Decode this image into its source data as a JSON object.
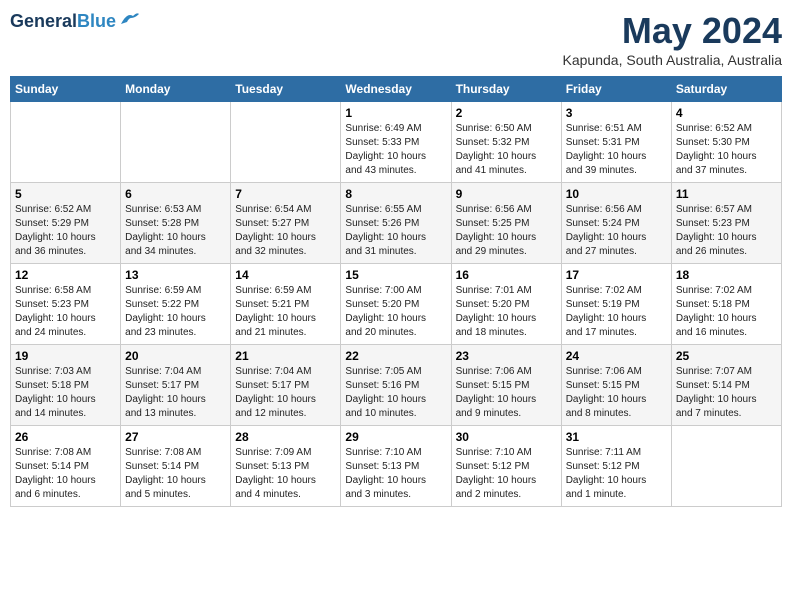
{
  "header": {
    "logo_line1": "General",
    "logo_line2": "Blue",
    "month_year": "May 2024",
    "location": "Kapunda, South Australia, Australia"
  },
  "weekdays": [
    "Sunday",
    "Monday",
    "Tuesday",
    "Wednesday",
    "Thursday",
    "Friday",
    "Saturday"
  ],
  "weeks": [
    [
      {
        "day": "",
        "info": ""
      },
      {
        "day": "",
        "info": ""
      },
      {
        "day": "",
        "info": ""
      },
      {
        "day": "1",
        "info": "Sunrise: 6:49 AM\nSunset: 5:33 PM\nDaylight: 10 hours\nand 43 minutes."
      },
      {
        "day": "2",
        "info": "Sunrise: 6:50 AM\nSunset: 5:32 PM\nDaylight: 10 hours\nand 41 minutes."
      },
      {
        "day": "3",
        "info": "Sunrise: 6:51 AM\nSunset: 5:31 PM\nDaylight: 10 hours\nand 39 minutes."
      },
      {
        "day": "4",
        "info": "Sunrise: 6:52 AM\nSunset: 5:30 PM\nDaylight: 10 hours\nand 37 minutes."
      }
    ],
    [
      {
        "day": "5",
        "info": "Sunrise: 6:52 AM\nSunset: 5:29 PM\nDaylight: 10 hours\nand 36 minutes."
      },
      {
        "day": "6",
        "info": "Sunrise: 6:53 AM\nSunset: 5:28 PM\nDaylight: 10 hours\nand 34 minutes."
      },
      {
        "day": "7",
        "info": "Sunrise: 6:54 AM\nSunset: 5:27 PM\nDaylight: 10 hours\nand 32 minutes."
      },
      {
        "day": "8",
        "info": "Sunrise: 6:55 AM\nSunset: 5:26 PM\nDaylight: 10 hours\nand 31 minutes."
      },
      {
        "day": "9",
        "info": "Sunrise: 6:56 AM\nSunset: 5:25 PM\nDaylight: 10 hours\nand 29 minutes."
      },
      {
        "day": "10",
        "info": "Sunrise: 6:56 AM\nSunset: 5:24 PM\nDaylight: 10 hours\nand 27 minutes."
      },
      {
        "day": "11",
        "info": "Sunrise: 6:57 AM\nSunset: 5:23 PM\nDaylight: 10 hours\nand 26 minutes."
      }
    ],
    [
      {
        "day": "12",
        "info": "Sunrise: 6:58 AM\nSunset: 5:23 PM\nDaylight: 10 hours\nand 24 minutes."
      },
      {
        "day": "13",
        "info": "Sunrise: 6:59 AM\nSunset: 5:22 PM\nDaylight: 10 hours\nand 23 minutes."
      },
      {
        "day": "14",
        "info": "Sunrise: 6:59 AM\nSunset: 5:21 PM\nDaylight: 10 hours\nand 21 minutes."
      },
      {
        "day": "15",
        "info": "Sunrise: 7:00 AM\nSunset: 5:20 PM\nDaylight: 10 hours\nand 20 minutes."
      },
      {
        "day": "16",
        "info": "Sunrise: 7:01 AM\nSunset: 5:20 PM\nDaylight: 10 hours\nand 18 minutes."
      },
      {
        "day": "17",
        "info": "Sunrise: 7:02 AM\nSunset: 5:19 PM\nDaylight: 10 hours\nand 17 minutes."
      },
      {
        "day": "18",
        "info": "Sunrise: 7:02 AM\nSunset: 5:18 PM\nDaylight: 10 hours\nand 16 minutes."
      }
    ],
    [
      {
        "day": "19",
        "info": "Sunrise: 7:03 AM\nSunset: 5:18 PM\nDaylight: 10 hours\nand 14 minutes."
      },
      {
        "day": "20",
        "info": "Sunrise: 7:04 AM\nSunset: 5:17 PM\nDaylight: 10 hours\nand 13 minutes."
      },
      {
        "day": "21",
        "info": "Sunrise: 7:04 AM\nSunset: 5:17 PM\nDaylight: 10 hours\nand 12 minutes."
      },
      {
        "day": "22",
        "info": "Sunrise: 7:05 AM\nSunset: 5:16 PM\nDaylight: 10 hours\nand 10 minutes."
      },
      {
        "day": "23",
        "info": "Sunrise: 7:06 AM\nSunset: 5:15 PM\nDaylight: 10 hours\nand 9 minutes."
      },
      {
        "day": "24",
        "info": "Sunrise: 7:06 AM\nSunset: 5:15 PM\nDaylight: 10 hours\nand 8 minutes."
      },
      {
        "day": "25",
        "info": "Sunrise: 7:07 AM\nSunset: 5:14 PM\nDaylight: 10 hours\nand 7 minutes."
      }
    ],
    [
      {
        "day": "26",
        "info": "Sunrise: 7:08 AM\nSunset: 5:14 PM\nDaylight: 10 hours\nand 6 minutes."
      },
      {
        "day": "27",
        "info": "Sunrise: 7:08 AM\nSunset: 5:14 PM\nDaylight: 10 hours\nand 5 minutes."
      },
      {
        "day": "28",
        "info": "Sunrise: 7:09 AM\nSunset: 5:13 PM\nDaylight: 10 hours\nand 4 minutes."
      },
      {
        "day": "29",
        "info": "Sunrise: 7:10 AM\nSunset: 5:13 PM\nDaylight: 10 hours\nand 3 minutes."
      },
      {
        "day": "30",
        "info": "Sunrise: 7:10 AM\nSunset: 5:12 PM\nDaylight: 10 hours\nand 2 minutes."
      },
      {
        "day": "31",
        "info": "Sunrise: 7:11 AM\nSunset: 5:12 PM\nDaylight: 10 hours\nand 1 minute."
      },
      {
        "day": "",
        "info": ""
      }
    ]
  ]
}
